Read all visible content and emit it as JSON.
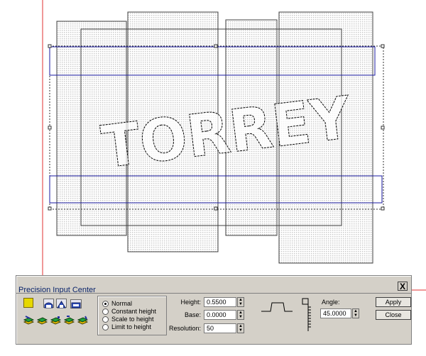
{
  "dialog": {
    "title": "Precision Input Center",
    "close_label": "X",
    "modes": [
      "Normal",
      "Constant height",
      "Scale to height",
      "Limit to height"
    ],
    "selected_mode": "Normal",
    "height_label": "Height:",
    "height_value": "0.5500",
    "base_label": "Base:",
    "base_value": "0.0000",
    "resolution_label": "Resolution:",
    "resolution_value": "50",
    "angle_label": "Angle:",
    "angle_value": "45.0000",
    "apply_label": "Apply",
    "close_button_label": "Close"
  },
  "canvas": {
    "text_outline": "TORREY",
    "colors": {
      "guide_red": "#e03030",
      "selection_blue": "#1a1aa0"
    }
  }
}
